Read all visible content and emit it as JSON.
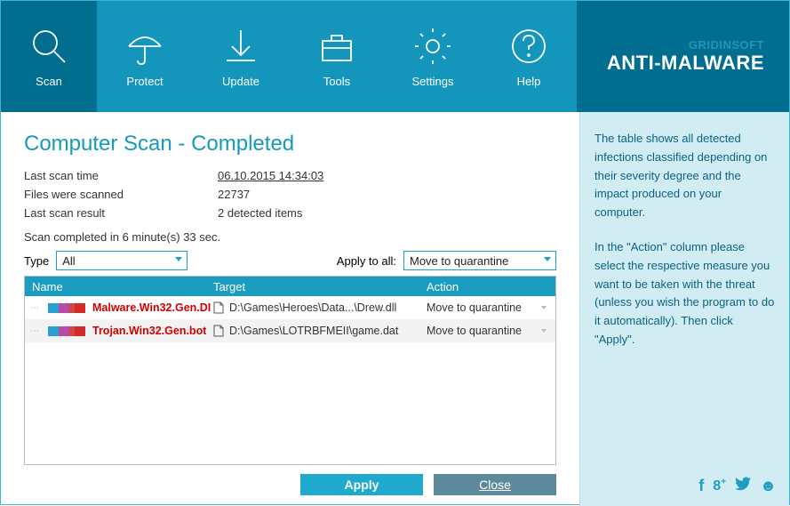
{
  "nav": {
    "items": [
      {
        "label": "Scan"
      },
      {
        "label": "Protect"
      },
      {
        "label": "Update"
      },
      {
        "label": "Tools"
      },
      {
        "label": "Settings"
      },
      {
        "label": "Help"
      }
    ]
  },
  "brand": {
    "top": "GRIDINSOFT",
    "bottom": "ANTI-MALWARE"
  },
  "page": {
    "title": "Computer Scan - Completed",
    "stats": {
      "last_scan_label": "Last scan time",
      "last_scan_value": "06.10.2015 14:34:03",
      "files_label": "Files were scanned",
      "files_value": "22737",
      "result_label": "Last scan result",
      "result_value": "2 detected items"
    },
    "summary": "Scan completed in 6 minute(s) 33 sec.",
    "type_label": "Type",
    "type_value": "All",
    "apply_label": "Apply to all:",
    "apply_value": "Move to quarantine",
    "columns": {
      "name": "Name",
      "target": "Target",
      "action": "Action"
    },
    "rows": [
      {
        "severity": [
          "#2aa0d0",
          "#2aa0d0",
          "#b84aa8",
          "#b84aa8",
          "#d24545",
          "#d42a2a",
          "#d42a2a"
        ],
        "threat": "Malware.Win32.Gen.DI",
        "target": "D:\\Games\\Heroes\\Data...\\Drew.dll",
        "action": "Move to quarantine"
      },
      {
        "severity": [
          "#2aa0d0",
          "#2aa0d0",
          "#b84aa8",
          "#b84aa8",
          "#d24545",
          "#d42a2a",
          "#d42a2a"
        ],
        "threat": "Trojan.Win32.Gen.bot",
        "target": "D:\\Games\\LOTRBFMEII\\game.dat",
        "action": "Move to quarantine"
      }
    ],
    "buttons": {
      "apply": "Apply",
      "close": "Close"
    }
  },
  "help": {
    "p1": "The table shows all detected infections classified depending on their severity degree and the impact produced on your computer.",
    "p2": "In the \"Action\" column please select the respective measure you want to be taken with the threat (unless you wish the program to do it automatically). Then click \"Apply\"."
  }
}
